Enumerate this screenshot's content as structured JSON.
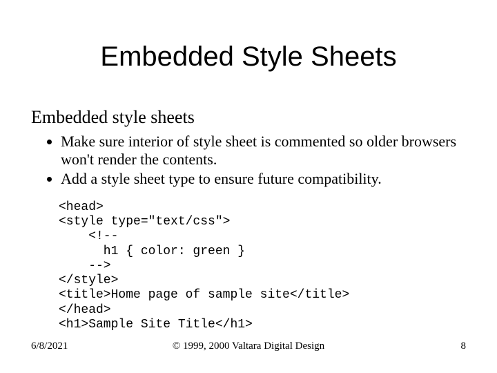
{
  "title": "Embedded Style Sheets",
  "subheading": "Embedded style sheets",
  "bullets": [
    "Make sure interior of style sheet is commented so older browsers won't render the contents.",
    "Add a style sheet type to ensure future compatibility."
  ],
  "code": "<head>\n<style type=\"text/css\">\n    <!--\n      h1 { color: green }\n    -->\n</style>\n<title>Home page of sample site</title>\n</head>\n<h1>Sample Site Title</h1>",
  "footer": {
    "date": "6/8/2021",
    "copyright": "© 1999, 2000 Valtara Digital Design",
    "page": "8"
  }
}
